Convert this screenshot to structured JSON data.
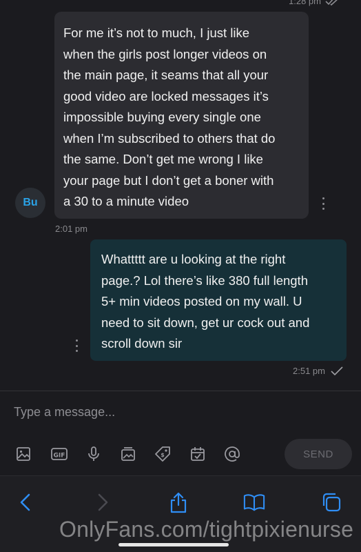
{
  "top": {
    "timestamp": "1:28 pm"
  },
  "incoming": {
    "avatar_initials": "Bu",
    "lines": [
      "For me it’s not to much, I just like",
      "when the girls post longer videos on",
      "the main page, it seams that all your",
      "good video are locked messages it’s",
      "impossible buying every single one",
      "when I’m subscribed to others that do",
      "the same. Don’t get me wrong I like",
      "your page but I don’t get a boner with",
      "a 30 to a minute video"
    ],
    "time": "2:01 pm"
  },
  "outgoing": {
    "lines": [
      "Whattttt are u looking at the right",
      "page.? Lol there’s like 380 full length",
      "5+ min videos posted on my wall. U",
      "need to sit down, get ur cock out and",
      "scroll down sir"
    ],
    "time": "2:51 pm"
  },
  "composer": {
    "placeholder": "Type a message...",
    "send_label": "SEND",
    "tools": [
      "image-icon",
      "gif-icon",
      "microphone-icon",
      "media-vault-icon",
      "price-tag-icon",
      "calendar-icon",
      "at-sign-icon"
    ]
  },
  "browser": {
    "watermark": "OnlyFans.com/tightpixienurse",
    "icons": [
      "back-icon",
      "forward-icon",
      "share-icon",
      "bookmarks-icon",
      "tabs-icon"
    ]
  },
  "colors": {
    "accent": "#2aa3e8",
    "outgoing_bubble": "#163038",
    "incoming_bubble": "#2c2c31"
  }
}
